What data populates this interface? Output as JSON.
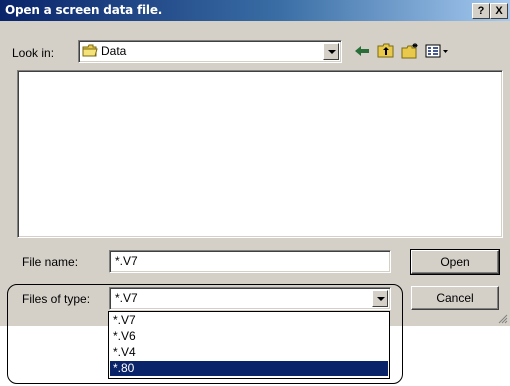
{
  "window": {
    "title": "Open a screen data file.",
    "help_label": "?",
    "close_label": "X"
  },
  "look_in": {
    "label": "Look in:",
    "value": "Data"
  },
  "file_name": {
    "label": "File name:",
    "value": "*.V7"
  },
  "files_of_type": {
    "label": "Files of type:",
    "value": "*.V7",
    "options": [
      "*.V7",
      "*.V6",
      "*.V4",
      "*.80"
    ],
    "selected_index": 3
  },
  "buttons": {
    "open_label": "Open",
    "cancel_label": "Cancel"
  },
  "icons": {
    "folder": "folder-icon",
    "back": "back-arrow-icon",
    "up": "up-folder-icon",
    "new_folder": "new-folder-icon",
    "view_menu": "view-menu-icon"
  },
  "colors": {
    "title_gradient_start": "#0a246a",
    "title_gradient_end": "#a6caf0",
    "selection": "#0a246a",
    "face": "#d4d0c8"
  }
}
